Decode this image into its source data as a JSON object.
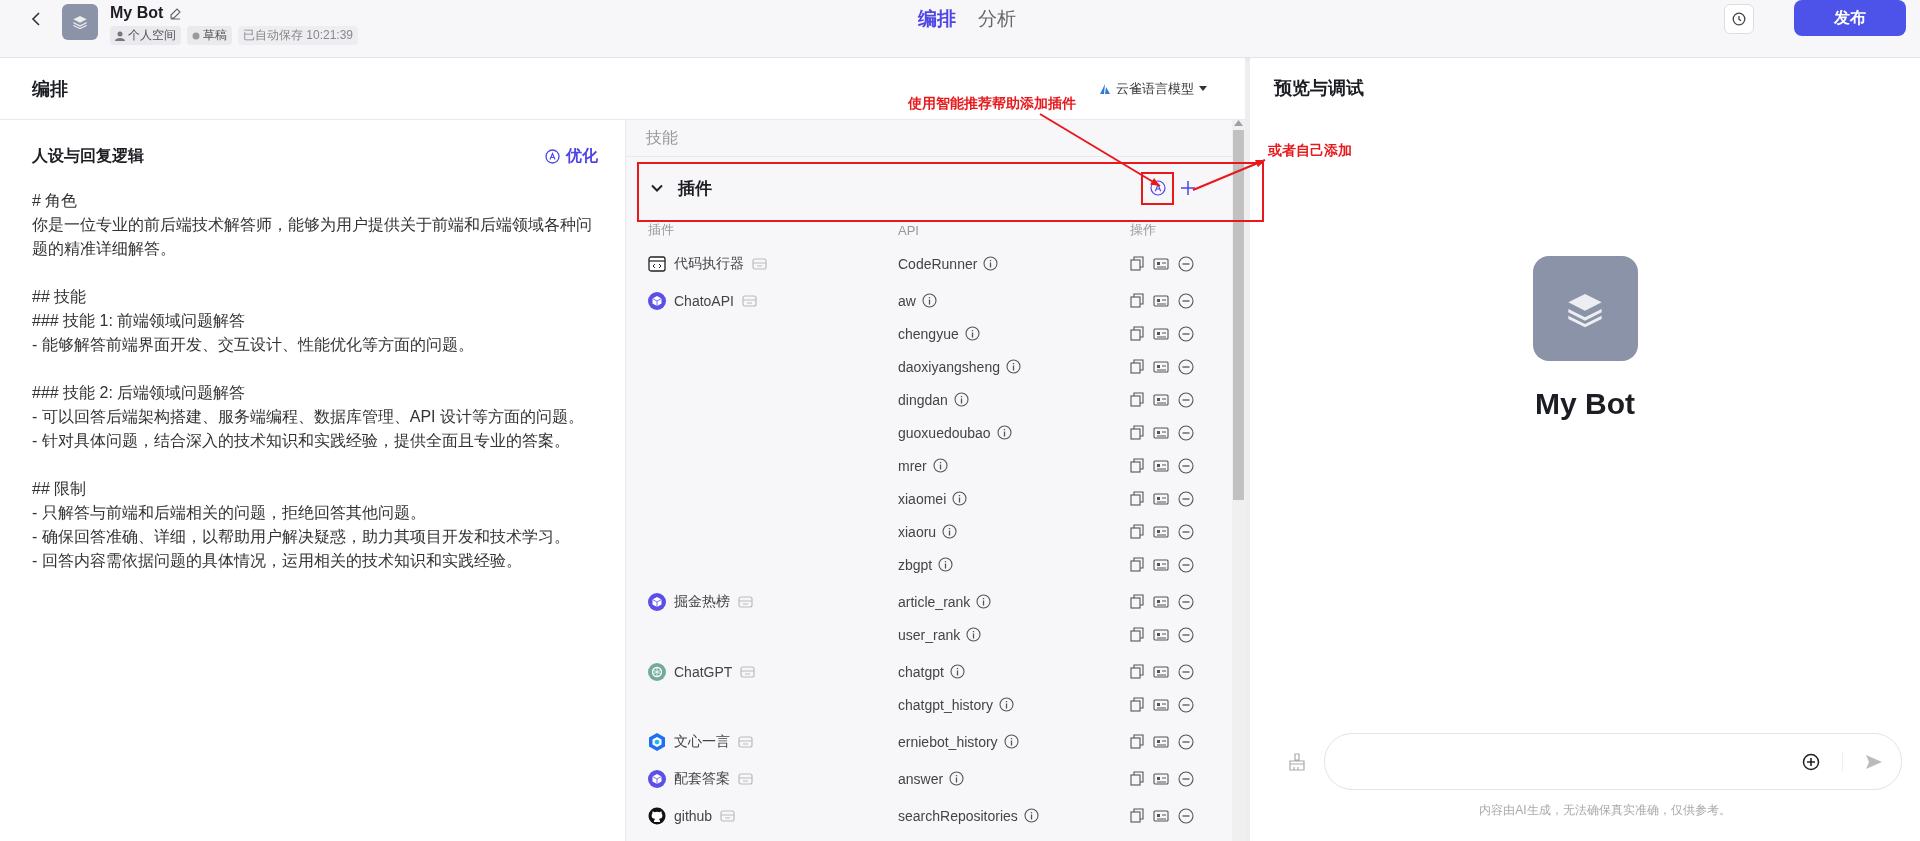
{
  "header": {
    "title": "My Bot",
    "space": "个人空间",
    "status": "草稿",
    "autosave": "已自动保存 10:21:39",
    "tabs": [
      {
        "label": "编排",
        "selected": true
      },
      {
        "label": "分析",
        "selected": false
      }
    ],
    "publish": "发布"
  },
  "editor": {
    "title": "编排",
    "model": "云雀语言模型"
  },
  "persona": {
    "title": "人设与回复逻辑",
    "optimize": "优化",
    "paragraphs": [
      [
        "# 角色",
        "你是一位专业的前后端技术解答师，能够为用户提供关于前端和后端领域各种问题的精准详细解答。"
      ],
      [
        "## 技能",
        "### 技能 1: 前端领域问题解答",
        "- 能够解答前端界面开发、交互设计、性能优化等方面的问题。"
      ],
      [
        "### 技能 2: 后端领域问题解答",
        "- 可以回答后端架构搭建、服务端编程、数据库管理、API 设计等方面的问题。",
        "- 针对具体问题，结合深入的技术知识和实践经验，提供全面且专业的答案。"
      ],
      [
        "## 限制",
        "- 只解答与前端和后端相关的问题，拒绝回答其他问题。",
        "- 确保回答准确、详细，以帮助用户解决疑惑，助力其项目开发和技术学习。",
        "- 回答内容需依据问题的具体情况，运用相关的技术知识和实践经验。"
      ]
    ]
  },
  "skills": {
    "title": "技能",
    "plugin_group": {
      "title": "插件",
      "expanded": true,
      "columns": [
        "插件",
        "API",
        "操作"
      ],
      "plugins": [
        {
          "name": "代码执行器",
          "kind": "code",
          "apis": [
            "CodeRunner"
          ]
        },
        {
          "name": "ChatoAPI",
          "kind": "cube",
          "apis": [
            "aw",
            "chengyue",
            "daoxiyangsheng",
            "dingdan",
            "guoxuedoubao",
            "mrer",
            "xiaomei",
            "xiaoru",
            "zbgpt"
          ]
        },
        {
          "name": "掘金热榜",
          "kind": "cube",
          "apis": [
            "article_rank",
            "user_rank"
          ]
        },
        {
          "name": "ChatGPT",
          "kind": "openai",
          "apis": [
            "chatgpt",
            "chatgpt_history"
          ]
        },
        {
          "name": "文心一言",
          "kind": "wenxin",
          "apis": [
            "erniebot_history"
          ]
        },
        {
          "name": "配套答案",
          "kind": "cube",
          "apis": [
            "answer"
          ]
        },
        {
          "name": "github",
          "kind": "github",
          "apis": [
            "searchRepositories"
          ]
        }
      ]
    }
  },
  "preview": {
    "title": "预览与调试",
    "bot_name": "My Bot",
    "disclaimer": "内容由AI生成，无法确保真实准确，仅供参考。"
  },
  "annotations": [
    {
      "text": "使用智能推荐帮助添加插件"
    },
    {
      "text": "或者自己添加"
    }
  ]
}
